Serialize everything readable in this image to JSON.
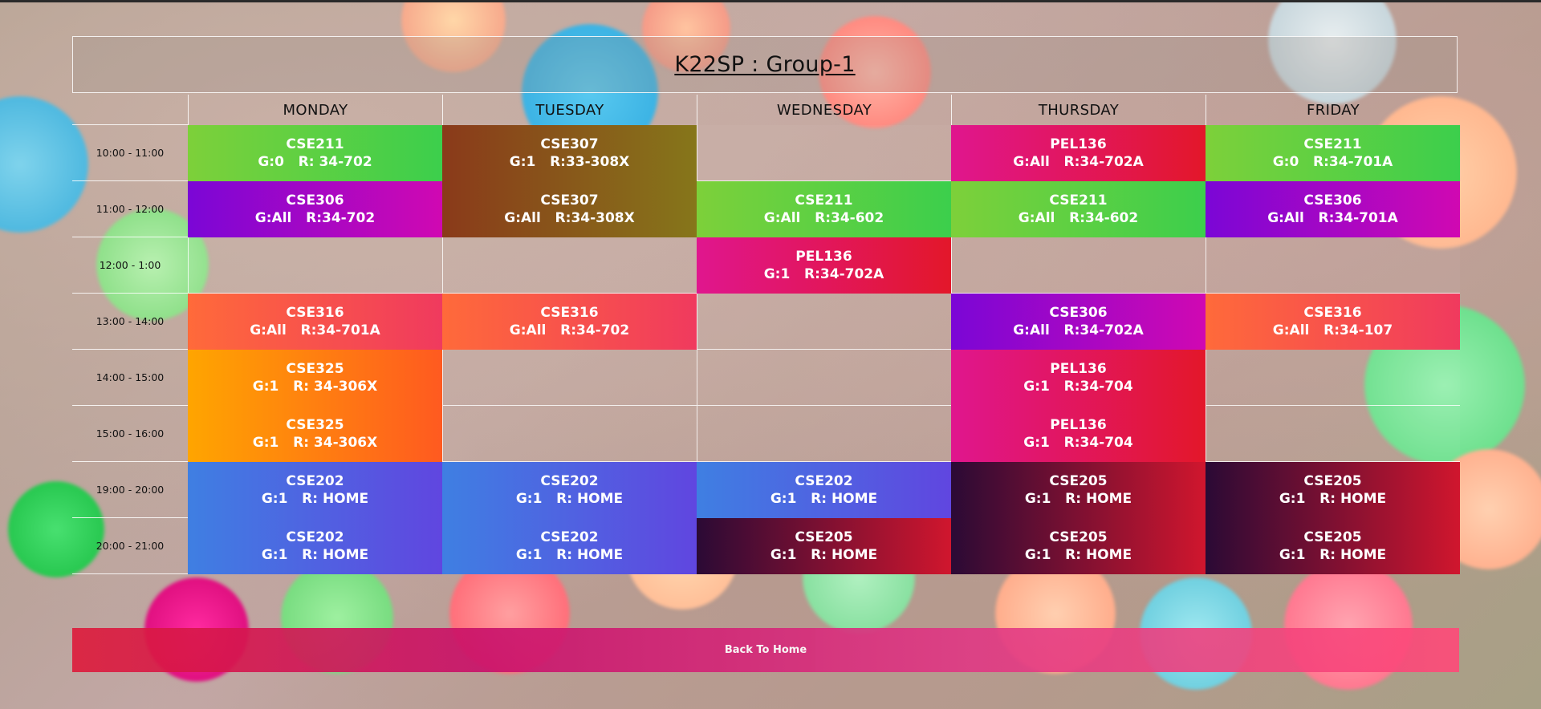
{
  "page": {
    "title": "K22SP : Group-1"
  },
  "days": [
    "MONDAY",
    "TUESDAY",
    "WEDNESDAY",
    "THURSDAY",
    "FRIDAY"
  ],
  "times": [
    "10:00 - 11:00",
    "11:00 - 12:00",
    "12:00 - 1:00",
    "13:00 - 14:00",
    "14:00 - 15:00",
    "15:00 - 16:00",
    "19:00 - 20:00",
    "20:00 - 21:00"
  ],
  "schedule": [
    [
      {
        "course": "CSE211",
        "info": "G:0   R: 34-702",
        "color": "green"
      },
      {
        "course": "CSE307",
        "info": "G:1   R:33-308X",
        "color": "brown"
      },
      null,
      {
        "course": "PEL136",
        "info": "G:All   R:34-702A",
        "color": "pink"
      },
      {
        "course": "CSE211",
        "info": "G:0   R:34-701A",
        "color": "green"
      }
    ],
    [
      {
        "course": "CSE306",
        "info": "G:All   R:34-702",
        "color": "purple"
      },
      {
        "course": "CSE307",
        "info": "G:All   R:34-308X",
        "color": "brown"
      },
      {
        "course": "CSE211",
        "info": "G:All   R:34-602",
        "color": "green"
      },
      {
        "course": "CSE211",
        "info": "G:All   R:34-602",
        "color": "green"
      },
      {
        "course": "CSE306",
        "info": "G:All   R:34-701A",
        "color": "purple"
      }
    ],
    [
      null,
      null,
      {
        "course": "PEL136",
        "info": "G:1   R:34-702A",
        "color": "pink"
      },
      null,
      null
    ],
    [
      {
        "course": "CSE316",
        "info": "G:All   R:34-701A",
        "color": "coral"
      },
      {
        "course": "CSE316",
        "info": "G:All   R:34-702",
        "color": "coral"
      },
      null,
      {
        "course": "CSE306",
        "info": "G:All   R:34-702A",
        "color": "purple"
      },
      {
        "course": "CSE316",
        "info": "G:All   R:34-107",
        "color": "coral"
      }
    ],
    [
      {
        "course": "CSE325",
        "info": "G:1   R: 34-306X",
        "color": "orange"
      },
      null,
      null,
      {
        "course": "PEL136",
        "info": "G:1   R:34-704",
        "color": "pink"
      },
      null
    ],
    [
      {
        "course": "CSE325",
        "info": "G:1   R: 34-306X",
        "color": "orange"
      },
      null,
      null,
      {
        "course": "PEL136",
        "info": "G:1   R:34-704",
        "color": "pink"
      },
      null
    ],
    [
      {
        "course": "CSE202",
        "info": "G:1   R: HOME",
        "color": "blue"
      },
      {
        "course": "CSE202",
        "info": "G:1   R: HOME",
        "color": "blue"
      },
      {
        "course": "CSE202",
        "info": "G:1   R: HOME",
        "color": "blue"
      },
      {
        "course": "CSE205",
        "info": "G:1   R: HOME",
        "color": "dark"
      },
      {
        "course": "CSE205",
        "info": "G:1   R: HOME",
        "color": "dark"
      }
    ],
    [
      {
        "course": "CSE202",
        "info": "G:1   R: HOME",
        "color": "blue"
      },
      {
        "course": "CSE202",
        "info": "G:1   R: HOME",
        "color": "blue"
      },
      {
        "course": "CSE205",
        "info": "G:1   R: HOME",
        "color": "dark"
      },
      {
        "course": "CSE205",
        "info": "G:1   R: HOME",
        "color": "dark"
      },
      {
        "course": "CSE205",
        "info": "G:1   R: HOME",
        "color": "dark"
      }
    ]
  ],
  "footer": {
    "back_label": "Back To Home"
  }
}
